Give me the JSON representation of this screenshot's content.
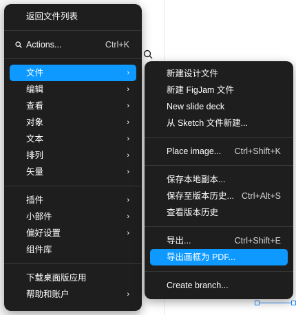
{
  "main_menu": {
    "back": "返回文件列表",
    "actions": {
      "label": "Actions...",
      "shortcut": "Ctrl+K"
    },
    "group1": [
      "文件",
      "编辑",
      "查看",
      "对象",
      "文本",
      "排列",
      "矢量"
    ],
    "group2": [
      "插件",
      "小部件",
      "偏好设置",
      "组件库"
    ],
    "group3": [
      "下载桌面版应用",
      "帮助和账户"
    ]
  },
  "sub_menu": {
    "new_design": "新建设计文件",
    "new_figjam": "新建 FigJam 文件",
    "new_slide": "New slide deck",
    "from_sketch": "从 Sketch 文件新建...",
    "place_image": {
      "label": "Place image...",
      "shortcut": "Ctrl+Shift+K"
    },
    "save_local": "保存本地副本...",
    "save_history": {
      "label": "保存至版本历史...",
      "shortcut": "Ctrl+Alt+S"
    },
    "view_history": "查看版本历史",
    "export": {
      "label": "导出...",
      "shortcut": "Ctrl+Shift+E"
    },
    "export_pdf": "导出画框为 PDF...",
    "create_branch": "Create branch..."
  },
  "icons": {
    "chevron": "chevron-right-icon",
    "search": "search-icon"
  },
  "colors": {
    "menu_bg": "#1e1e1e",
    "highlight": "#0d99ff"
  }
}
